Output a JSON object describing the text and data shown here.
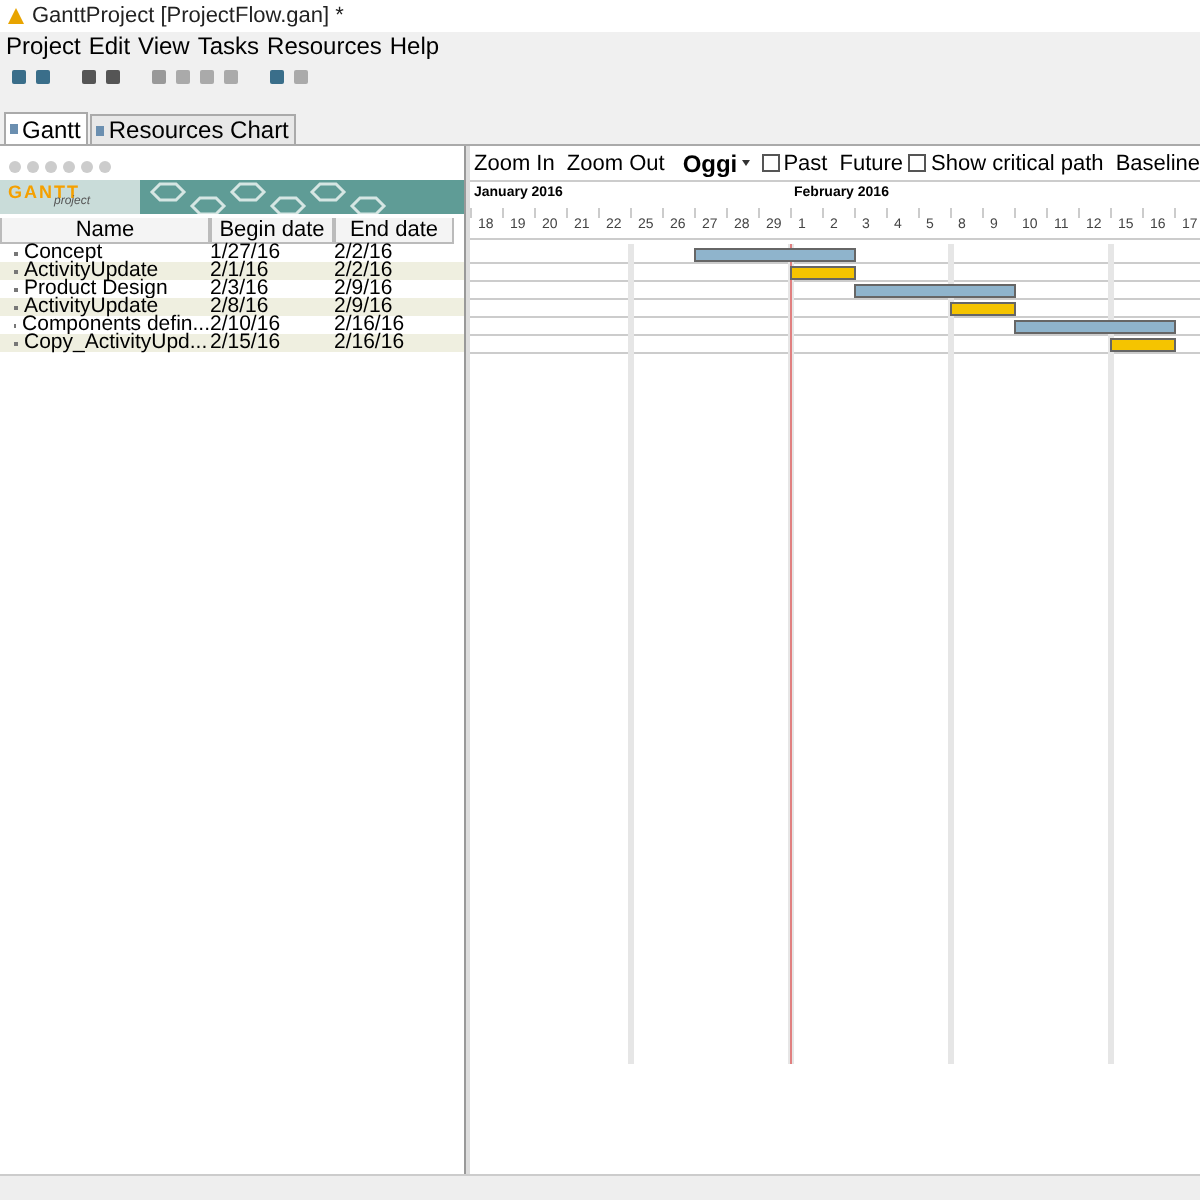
{
  "window": {
    "title": "GanttProject [ProjectFlow.gan] *"
  },
  "menu": [
    "Project",
    "Edit",
    "View",
    "Tasks",
    "Resources",
    "Help"
  ],
  "tabs": [
    {
      "label": "Gantt",
      "selected": true
    },
    {
      "label": "Resources Chart",
      "selected": false
    }
  ],
  "logo": {
    "word": "GANTT",
    "sub": "project"
  },
  "table": {
    "columns": [
      "Name",
      "Begin date",
      "End date"
    ],
    "rows": [
      {
        "name": "Concept",
        "begin": "1/27/16",
        "end": "2/2/16",
        "color": "#8fb4cc"
      },
      {
        "name": "ActivityUpdate",
        "begin": "2/1/16",
        "end": "2/2/16",
        "color": "#f5c400"
      },
      {
        "name": "Product Design",
        "begin": "2/3/16",
        "end": "2/9/16",
        "color": "#8fb4cc"
      },
      {
        "name": "ActivityUpdate",
        "begin": "2/8/16",
        "end": "2/9/16",
        "color": "#f5c400"
      },
      {
        "name": "Components defin...",
        "begin": "2/10/16",
        "end": "2/16/16",
        "color": "#8fb4cc"
      },
      {
        "name": "Copy_ActivityUpd...",
        "begin": "2/15/16",
        "end": "2/16/16",
        "color": "#f5c400"
      }
    ]
  },
  "chart_toolbar": {
    "zoom_in": "Zoom In",
    "zoom_out": "Zoom Out",
    "today": "Oggi",
    "past": {
      "label": "Past",
      "checked": false
    },
    "future": {
      "label": "Future",
      "checked": false
    },
    "critical": "Show critical path",
    "baselines": "Baseline"
  },
  "timeline": {
    "months": [
      "January 2016",
      "February 2016"
    ],
    "days": [
      "18",
      "19",
      "20",
      "21",
      "22",
      "25",
      "26",
      "27",
      "28",
      "29",
      "1",
      "2",
      "3",
      "4",
      "5",
      "8",
      "9",
      "10",
      "11",
      "12",
      "15",
      "16",
      "17"
    ]
  }
}
